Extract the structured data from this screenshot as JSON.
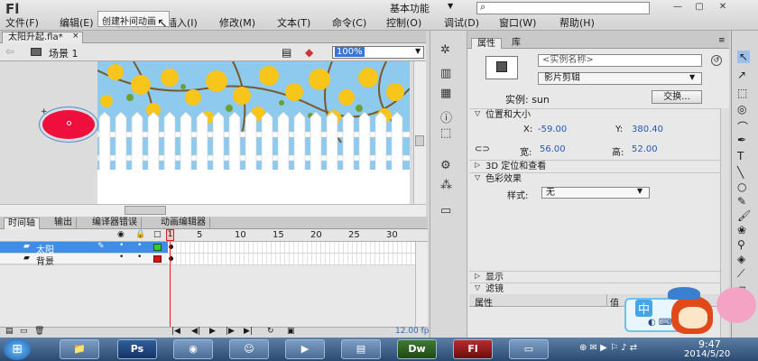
{
  "app": {
    "logo": "Fl",
    "workspace": "基本功能",
    "menus": [
      "文件(F)",
      "编辑(E)",
      "视图(V)",
      "插入(I)",
      "修改(M)",
      "文本(T)",
      "命令(C)",
      "控制(O)",
      "调试(D)",
      "窗口(W)",
      "帮助(H)"
    ],
    "tooltip": "创建补间动画",
    "window_buttons": [
      "—",
      "▢",
      "✕"
    ]
  },
  "document": {
    "tab": "太阳升起.fla*",
    "scene": "场景 1",
    "zoom": "100%"
  },
  "panel_tabs": [
    "时间轴",
    "输出",
    "编译器错误",
    "动画编辑器"
  ],
  "timeline": {
    "ruler": [
      "1",
      "5",
      "10",
      "15",
      "20",
      "25",
      "30"
    ],
    "current_frame": "1",
    "layers": [
      {
        "name": "太阳",
        "color": "#33cc33",
        "selected": true
      },
      {
        "name": "背景",
        "color": "#dd1111",
        "selected": false
      }
    ],
    "fps": "12.00 fps"
  },
  "properties": {
    "tabs": [
      "属性",
      "库"
    ],
    "instance_name_placeholder": "<实例名称>",
    "symbol_type": "影片剪辑",
    "instance_label": "实例: sun",
    "swap_button": "交换...",
    "sections": {
      "position_size": "位置和大小",
      "3d": "3D 定位和查看",
      "color": "色彩效果",
      "display": "显示",
      "filter": "滤镜"
    },
    "x_label": "X:",
    "x_value": "-59.00",
    "y_label": "Y:",
    "y_value": "380.40",
    "w_label": "宽:",
    "w_value": "56.00",
    "h_label": "高:",
    "h_value": "52.00",
    "style_label": "样式:",
    "style_value": "无",
    "filter_columns": [
      "属性",
      "值"
    ]
  },
  "ime": {
    "label": "中"
  },
  "taskbar": {
    "apps": [
      "Ps",
      "Dw",
      "Fl"
    ],
    "time": "9:47",
    "date": "2014/5/20"
  },
  "colors": {
    "sun": "#ee0f3d",
    "selection": "#3f8de7",
    "accent": "#2759b5"
  }
}
